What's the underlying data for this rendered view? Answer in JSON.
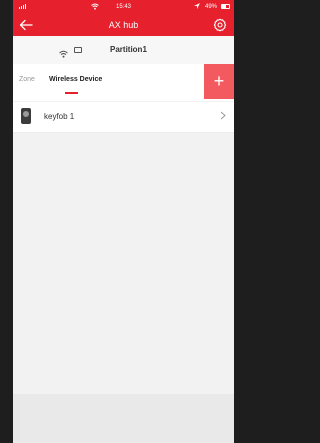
{
  "status_bar": {
    "time": "15:43",
    "battery": "49%"
  },
  "nav": {
    "title": "AX hub"
  },
  "partition": {
    "name": "Partition1"
  },
  "tabs": [
    {
      "label": "Zone",
      "active": false
    },
    {
      "label": "Wireless Device",
      "active": true
    }
  ],
  "add_label": "+",
  "devices": [
    {
      "name": "keyfob 1"
    }
  ],
  "colors": {
    "brand_red": "#e6202c",
    "add_button": "#f25a5f"
  },
  "icons": {
    "back": "back-arrow-icon",
    "settings": "gear-icon",
    "wifi": "wifi-icon",
    "device": "keyfob-icon",
    "chevron": "chevron-right-icon"
  }
}
